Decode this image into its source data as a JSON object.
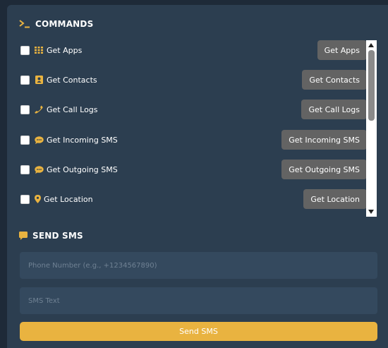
{
  "colors": {
    "background": "#1e2a38",
    "panel": "#2c3e50",
    "accent": "#e9b340",
    "button": "#636363",
    "input": "#34495e"
  },
  "commands": {
    "title": "COMMANDS",
    "icon": "terminal-icon",
    "items": [
      {
        "label": "Get Apps",
        "icon": "grid-icon",
        "button": "Get Apps"
      },
      {
        "label": "Get Contacts",
        "icon": "contact-book-icon",
        "button": "Get Contacts"
      },
      {
        "label": "Get Call Logs",
        "icon": "phone-icon",
        "button": "Get Call Logs"
      },
      {
        "label": "Get Incoming SMS",
        "icon": "chat-bubble-icon",
        "button": "Get Incoming SMS"
      },
      {
        "label": "Get Outgoing SMS",
        "icon": "chat-bubble-icon",
        "button": "Get Outgoing SMS"
      },
      {
        "label": "Get Location",
        "icon": "map-pin-icon",
        "button": "Get Location"
      }
    ]
  },
  "send_sms": {
    "title": "SEND SMS",
    "icon": "message-icon",
    "phone_placeholder": "Phone Number (e.g., +1234567890)",
    "text_placeholder": "SMS Text",
    "button": "Send SMS"
  }
}
